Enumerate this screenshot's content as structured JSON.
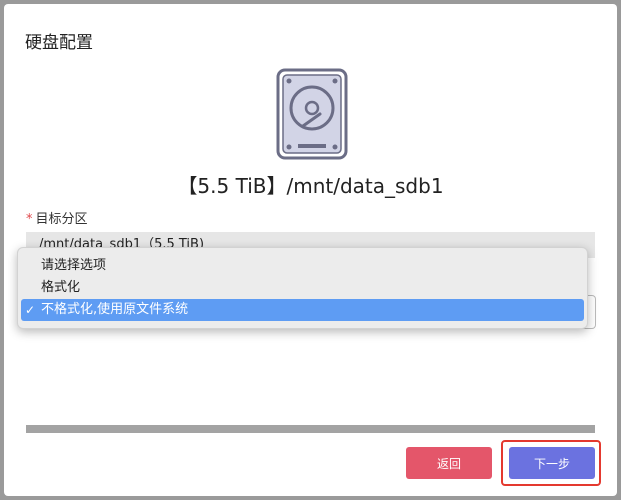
{
  "dialog": {
    "title": "硬盘配置",
    "disk_name": "【5.5 TiB】/mnt/data_sdb1"
  },
  "form": {
    "required_mark": "*",
    "target_partition_label": "目标分区",
    "target_partition_value": "/mnt/data_sdb1（5.5 TiB)"
  },
  "format_dropdown": {
    "options": [
      {
        "label": "请选择选项",
        "selected": false
      },
      {
        "label": "格式化",
        "selected": false
      },
      {
        "label": "不格式化,使用原文件系统",
        "selected": true
      }
    ],
    "check_mark": "✓"
  },
  "progress": {
    "fraction": 1.0
  },
  "buttons": {
    "back": "返回",
    "next": "下一步"
  },
  "icons": [
    "hard-disk-icon",
    "chevron-updown-icon",
    "check-icon"
  ],
  "colors": {
    "back_button": "#e4566a",
    "next_button": "#6b72e0",
    "selected_option": "#5e9cf3",
    "highlight_border": "#e4392f",
    "required": "#e0474b"
  }
}
